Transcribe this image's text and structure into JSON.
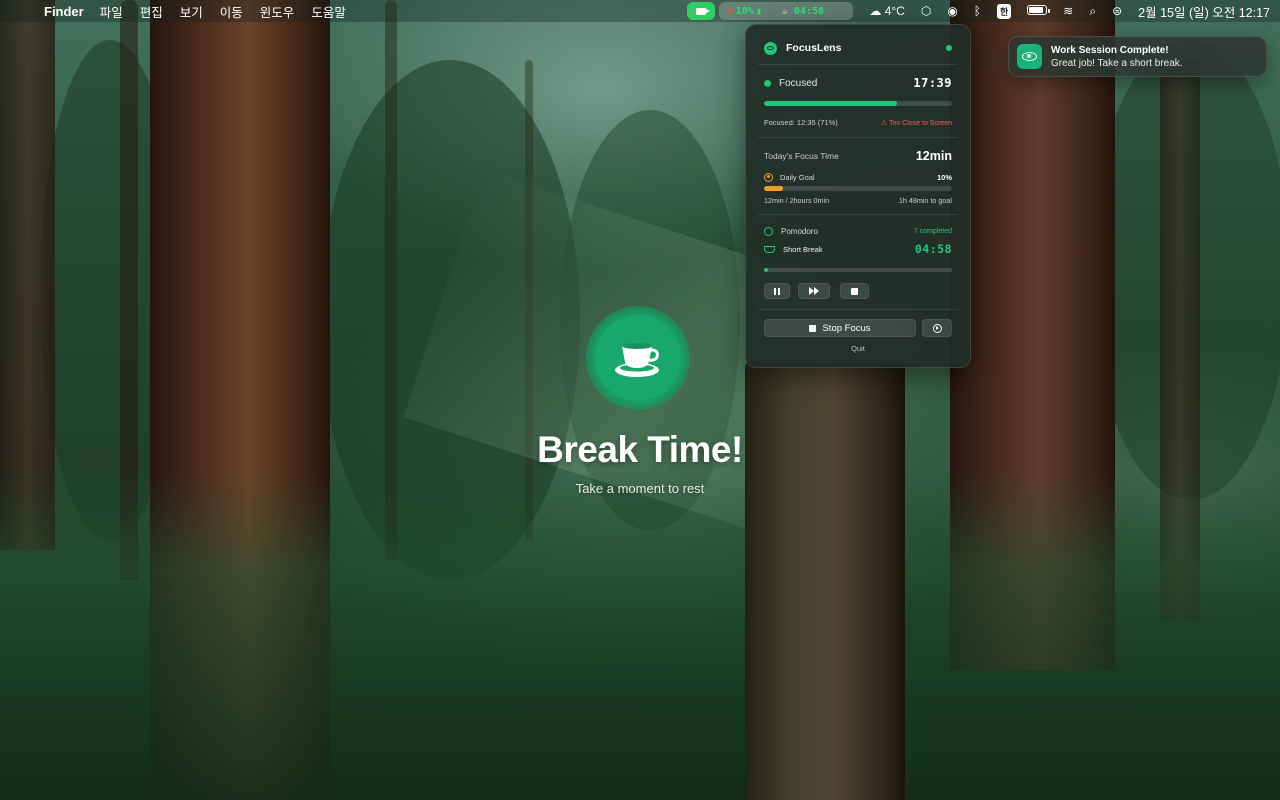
{
  "menubar": {
    "app_name": "Finder",
    "menus": [
      "파일",
      "편집",
      "보기",
      "이동",
      "윈도우",
      "도움말"
    ],
    "status_pill": {
      "battery_text": "10%",
      "timer_text": "04:58"
    },
    "weather": "4°C",
    "input_source": "한",
    "clock": "2월 15일 (일) 오전 12:17"
  },
  "break_overlay": {
    "title": "Break Time!",
    "subtitle": "Take a moment to rest"
  },
  "panel": {
    "title": "FocusLens",
    "status_label": "Focused",
    "status_time": "17:39",
    "focused_detail": "Focused: 12:35 (71%)",
    "focused_progress": 0.71,
    "warning": "Too Close to Screen",
    "today_label": "Today's Focus Time",
    "today_value": "12min",
    "goal_label": "Daily Goal",
    "goal_percent": "10%",
    "goal_progress": 0.1,
    "goal_detail_left": "12min / 2hours 0min",
    "goal_detail_right": "1h 48min to goal",
    "pomodoro_label": "Pomodoro",
    "pomodoro_completed": "7 completed",
    "phase_label": "Short Break",
    "phase_time": "04:58",
    "phase_progress": 0.02,
    "stop_label": "Stop Focus",
    "quit_label": "Quit"
  },
  "notification": {
    "title": "Work Session Complete!",
    "body": "Great job! Take a short break."
  },
  "colors": {
    "accent_green": "#22c57a",
    "goal_orange": "#f0a12a",
    "warning_red": "#ff5a4a"
  }
}
